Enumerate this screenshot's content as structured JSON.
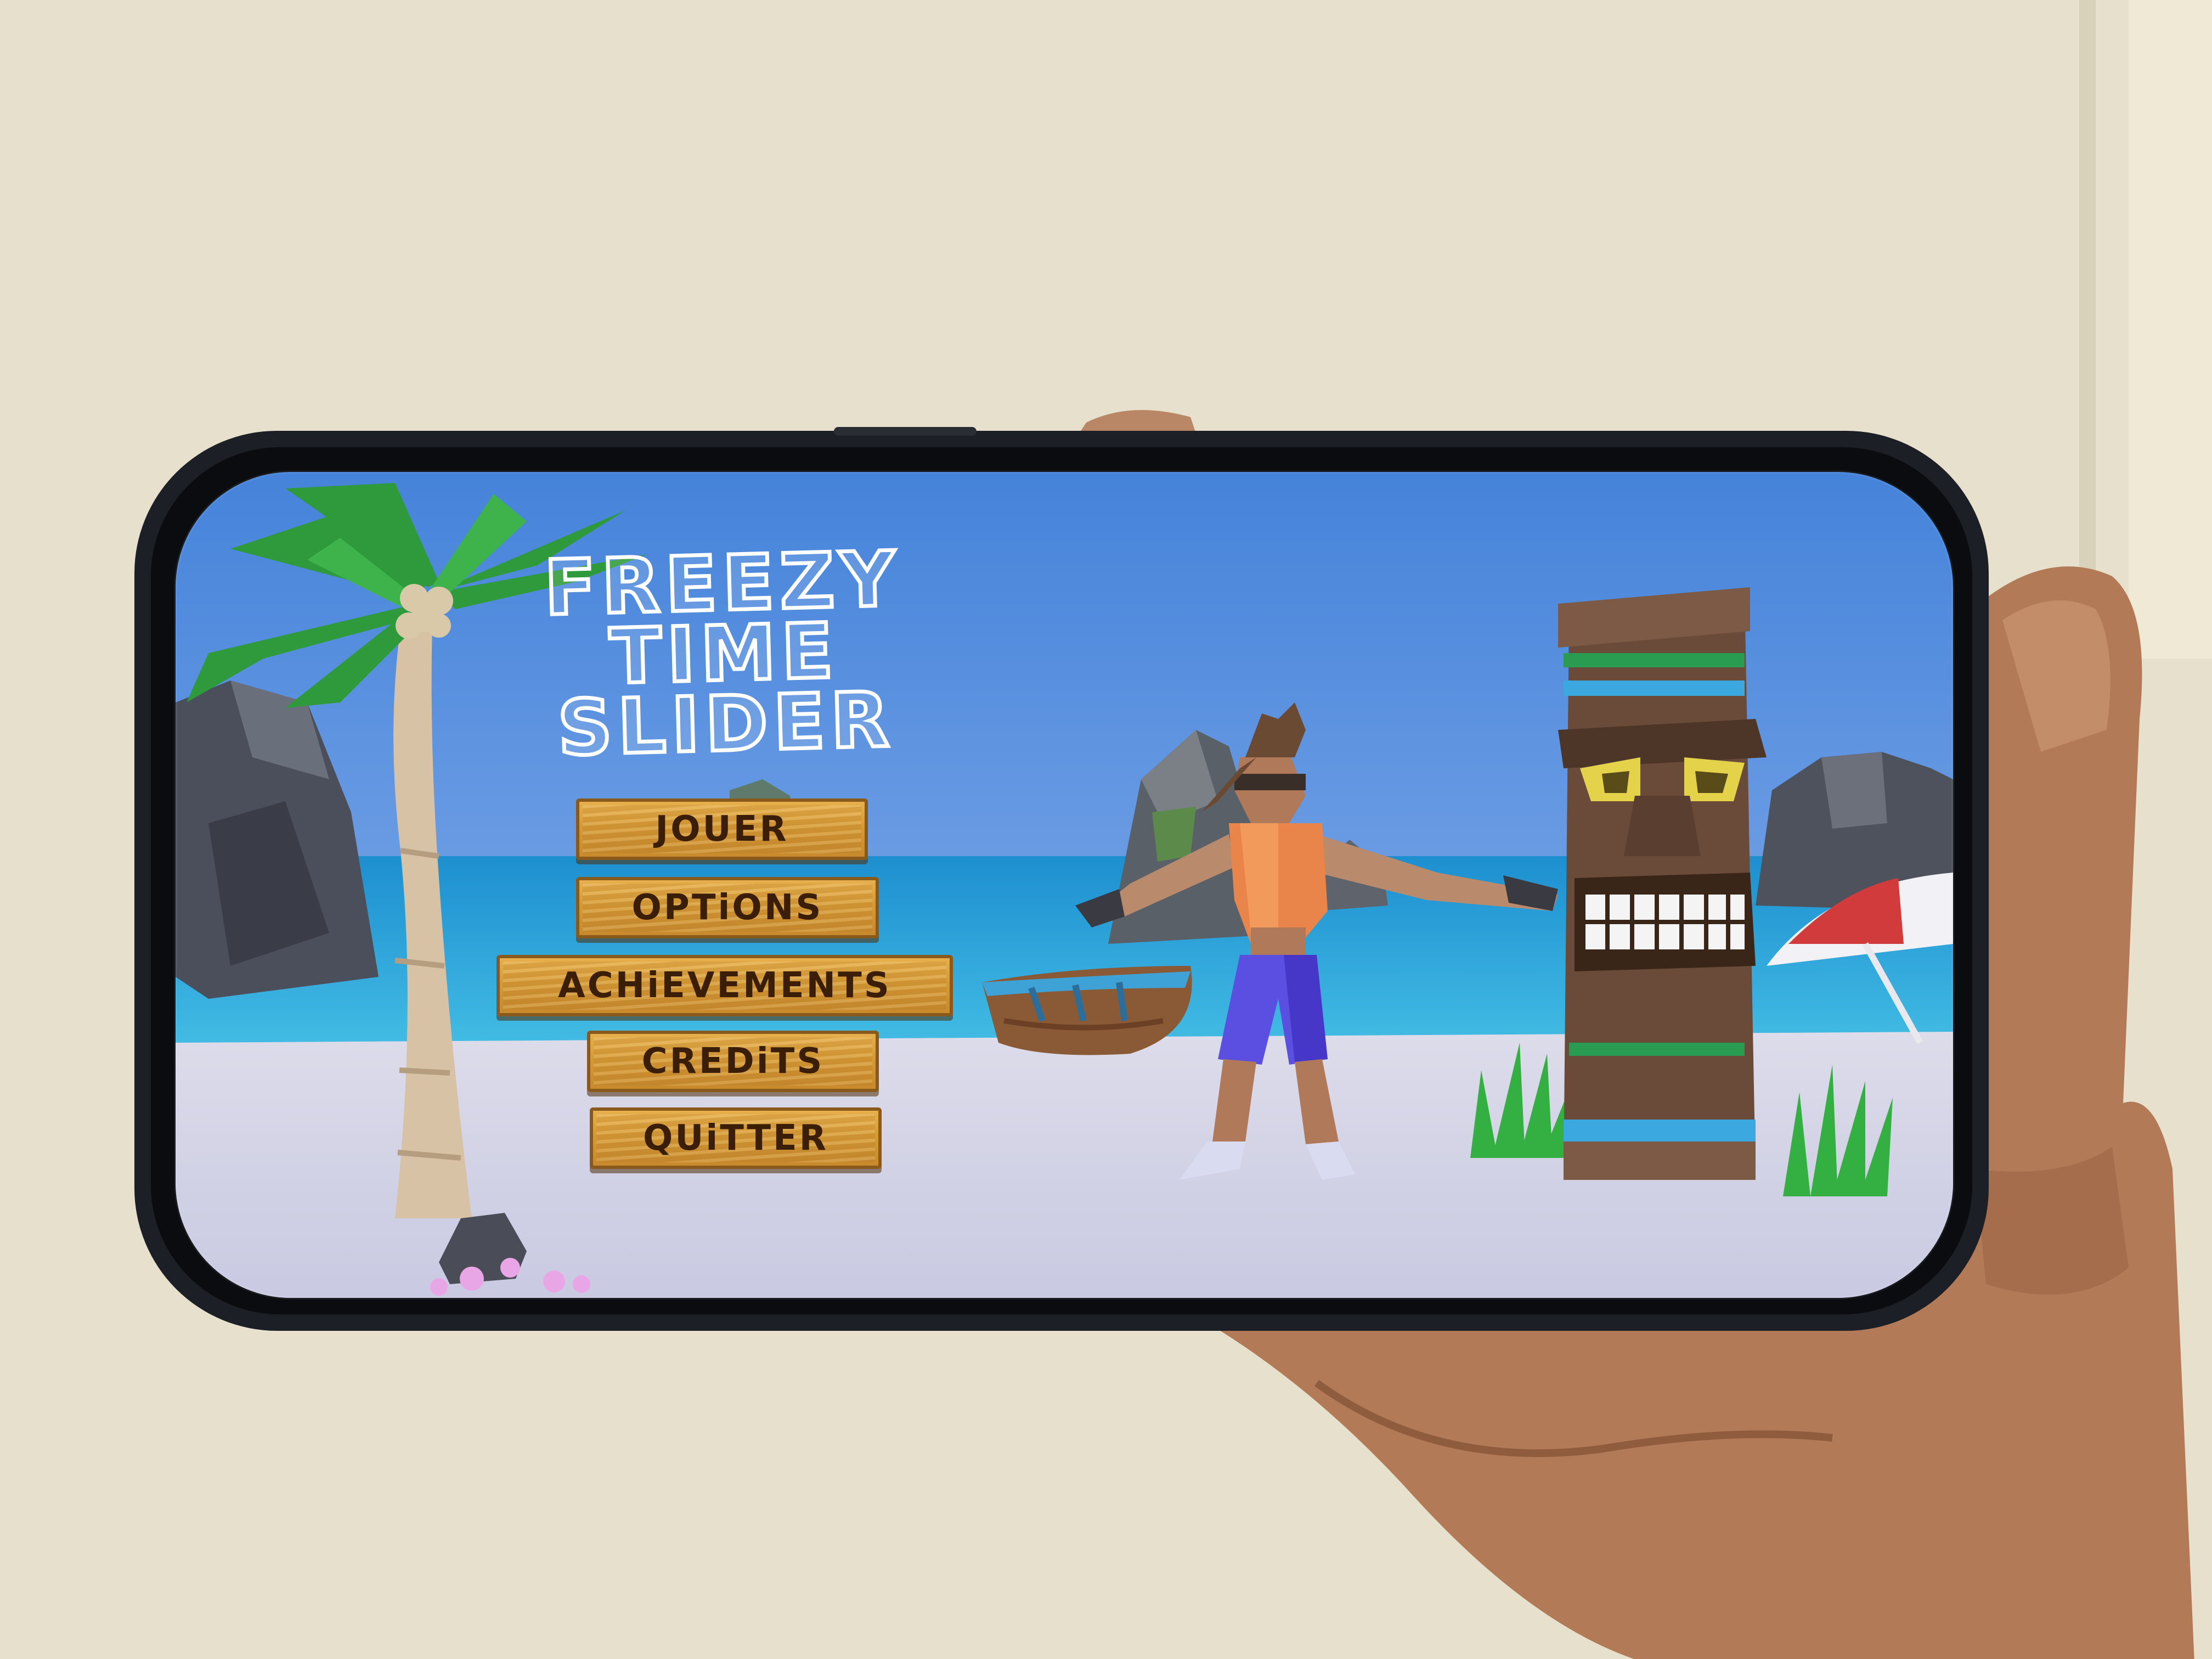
{
  "game": {
    "title_lines": [
      "FREEZY",
      "TIME",
      "SLIDER"
    ]
  },
  "menu": {
    "items": [
      {
        "label": "JOUER"
      },
      {
        "label": "OPTiONS"
      },
      {
        "label": "ACHiEVEMENTS"
      },
      {
        "label": "CREDiTS"
      },
      {
        "label": "QUiTTER"
      }
    ]
  },
  "colors": {
    "sky_top": "#4a86dc",
    "sky_bottom": "#8fb4ec",
    "sea": "#2aa8d8",
    "sand": "#d3d3e8",
    "button_wood": "#d8a03c",
    "button_text": "#3b1e08",
    "title_outline": "#ffffff"
  }
}
